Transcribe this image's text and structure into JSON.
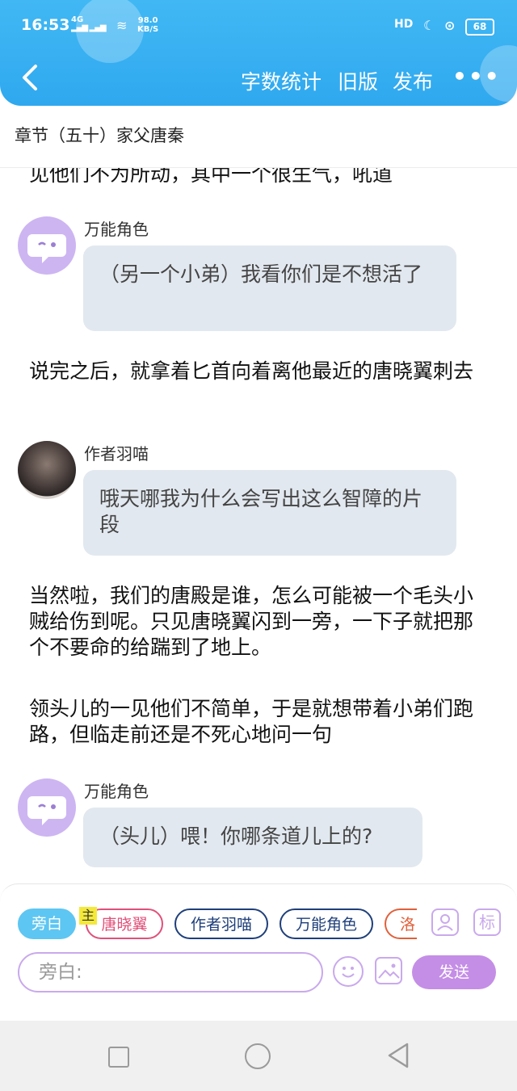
{
  "status_bar": {
    "time": "16:53",
    "signal": "4G",
    "speed_value": "98.0",
    "speed_unit": "KB/S",
    "hd_label": "HD",
    "battery": "68"
  },
  "topbar": {
    "word_count": "字数统计",
    "old_version": "旧版",
    "publish": "发布",
    "more": "•••"
  },
  "chapter_title": "章节（五十）家父唐秦",
  "content": {
    "cut_line": "见他们不为所动，其中一个很生气，吼道",
    "msg1_speaker": "万能角色",
    "msg1_text": "（另一个小弟）我看你们是不想活了",
    "para1": "说完之后，就拿着匕首向着离他最近的唐晓翼刺去",
    "msg2_speaker": "作者羽喵",
    "msg2_text": "哦天哪我为什么会写出这么智障的片段",
    "para2": "当然啦，我们的唐殿是谁，怎么可能被一个毛头小贼给伤到呢。只见唐晓翼闪到一旁，一下子就把那个不要命的给踹到了地上。",
    "para3": "领头儿的一见他们不简单，于是就想带着小弟们跑路，但临走前还是不死心地问一句",
    "msg3_speaker": "万能角色",
    "msg3_text": "（头儿）喂！你哪条道儿上的?"
  },
  "composer": {
    "chips": {
      "side": "旁白",
      "main_tag": "主",
      "tang": "唐晓翼",
      "author": "作者羽喵",
      "universal": "万能角色",
      "luo": "洛"
    },
    "tag_icon_label": "标",
    "input_placeholder": "旁白:",
    "send": "发送"
  },
  "colors": {
    "header": "#2fa8ef",
    "accent_purple": "#c48ee6",
    "chip_side": "#5ec6f2",
    "chip_tang": "#e0507a",
    "chip_blue": "#1f3f7a",
    "chip_luo": "#e0603a",
    "bubble_bg": "#e2e8ef"
  }
}
